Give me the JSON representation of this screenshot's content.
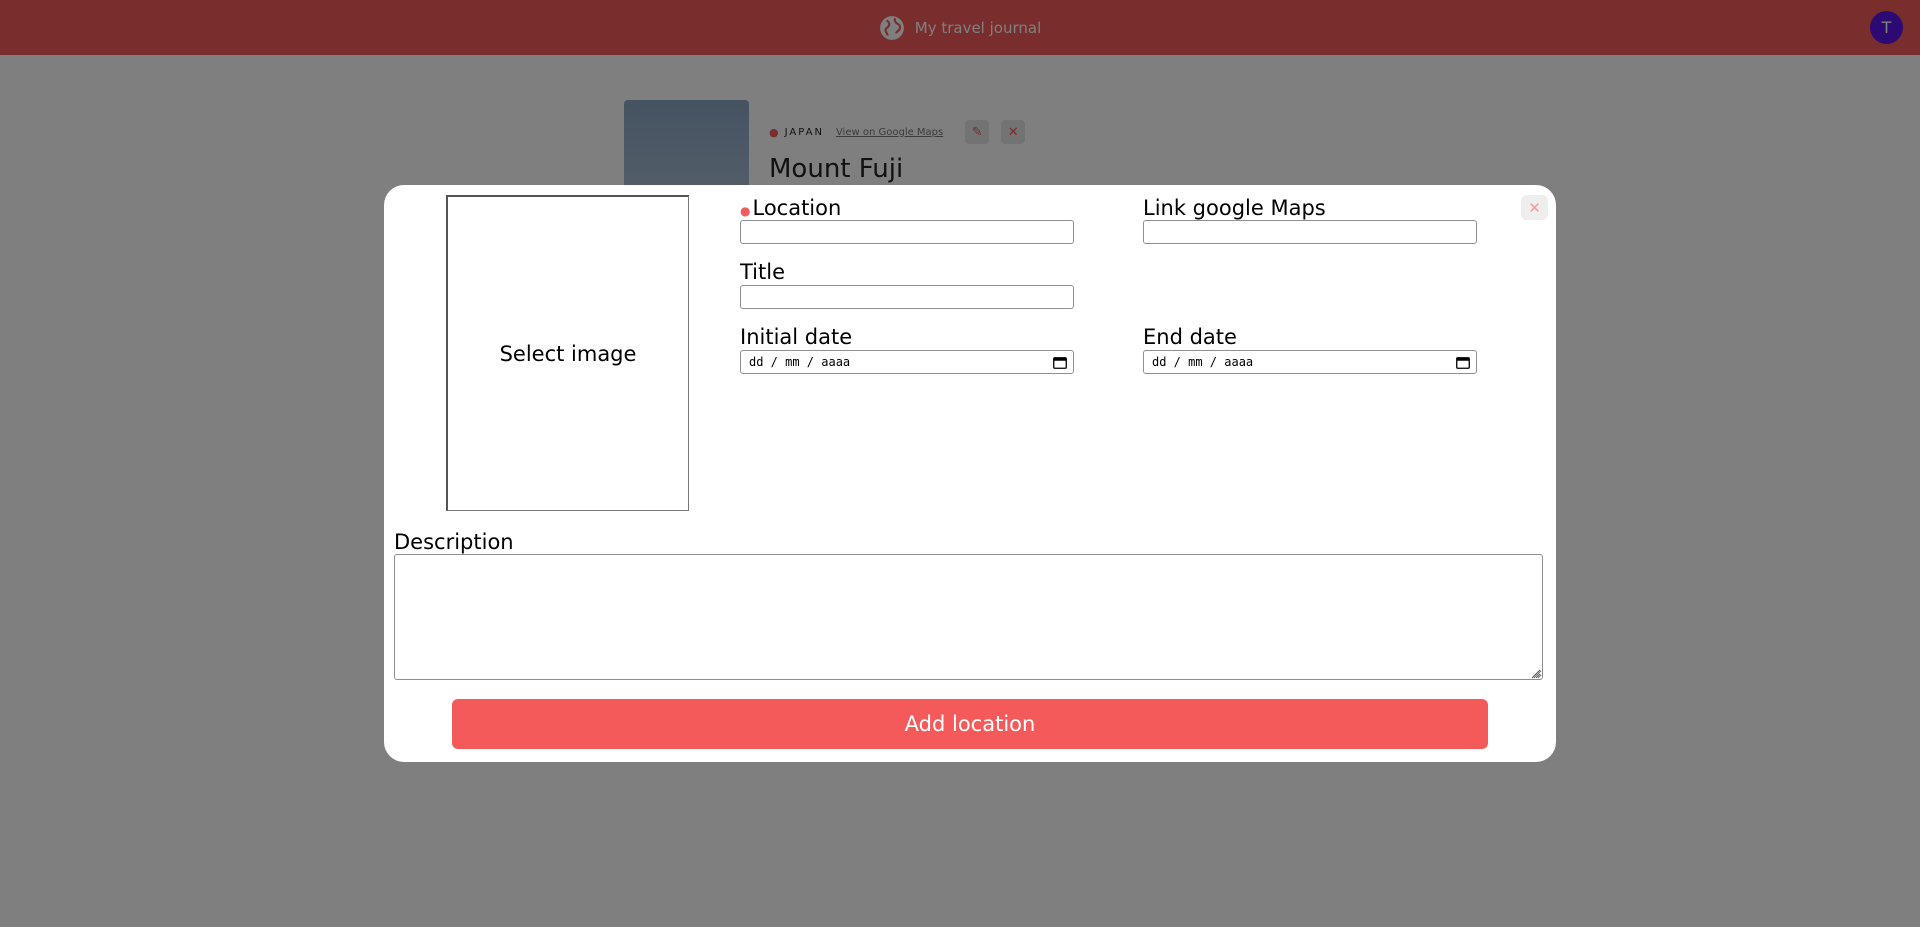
{
  "header": {
    "title": "My travel journal",
    "icon": "globe-icon",
    "avatar_initial": "T",
    "brand_color": "#f25b5b",
    "avatar_color": "#5a14e6"
  },
  "entry": {
    "country": "JAPAN",
    "maps_link": "View on Google Maps",
    "title": "Mount Fuji",
    "edit_icon": "pencil-icon",
    "delete_icon": "close-icon"
  },
  "modal": {
    "close_icon": "close-icon",
    "close_glyph": "✕",
    "image_picker_label": "Select image",
    "location_label": "Location",
    "location_value": "",
    "maps_label": "Link google Maps",
    "maps_value": "",
    "title_label": "Title",
    "title_value": "",
    "initial_date_label": "Initial date",
    "initial_date_placeholder": "dd / mm / aaaa",
    "end_date_label": "End date",
    "end_date_placeholder": "dd / mm / aaaa",
    "description_label": "Description",
    "description_value": "",
    "submit_label": "Add location",
    "submit_color": "#f55a5a"
  }
}
